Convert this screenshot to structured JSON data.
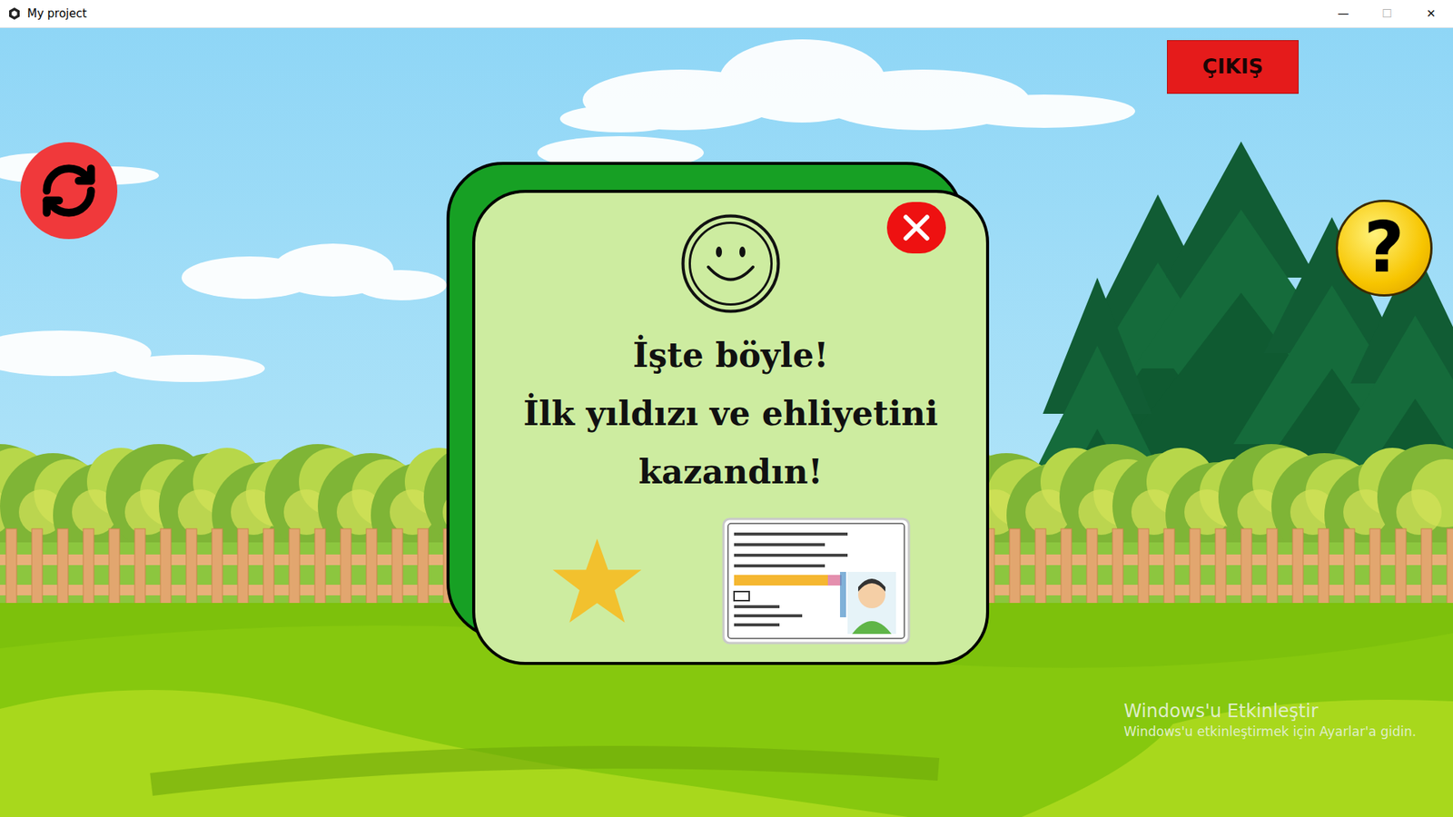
{
  "window": {
    "title": "My project",
    "controls": [
      {
        "label": "—",
        "disabled": false
      },
      {
        "label": "☐",
        "disabled": true
      },
      {
        "label": "✕",
        "disabled": false
      }
    ]
  },
  "exit_button": {
    "label": "ÇIKIŞ"
  },
  "help_button": {
    "label": "?"
  },
  "dialog": {
    "lines": [
      "İşte böyle!",
      "İlk yıldızı ve ehliyetini",
      "kazandın!"
    ],
    "stars": 1
  },
  "watermark": {
    "title": "Windows'u Etkinleştir",
    "subtitle": "Windows'u etkinleştirmek için Ayarlar'a gidin."
  }
}
